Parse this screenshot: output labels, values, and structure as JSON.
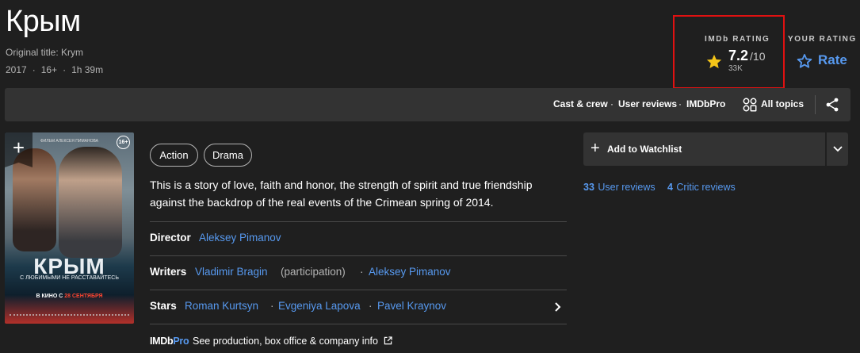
{
  "title": {
    "main": "Крым",
    "original": "Original title: Krym",
    "year": "2017",
    "age": "16+",
    "runtime": "1h 39m",
    "dot": "·"
  },
  "rating": {
    "imdb_label": "IMDb RATING",
    "score": "7.2",
    "out_of": "/10",
    "votes": "33K",
    "your_label": "YOUR RATING",
    "rate_label": "Rate"
  },
  "nav": {
    "cast_crew": "Cast & crew",
    "user_reviews": "User reviews",
    "imdbpro": "IMDbPro",
    "all_topics": "All topics",
    "sep": "·"
  },
  "poster": {
    "top_text": "ФИЛЬМ АЛЕКСЕЯ ПИМАНОВА",
    "age": "16+",
    "name": "КРЫМ",
    "tagline": "С ЛЮБИМЫМИ НЕ РАССТАВАЙТЕСЬ",
    "release_prefix": "В КИНО С",
    "release_date": "28 СЕНТЯБРЯ",
    "add": "+"
  },
  "genres": [
    "Action",
    "Drama"
  ],
  "plot": "This is a story of love, faith and honor, the strength of spirit and true friendship against the backdrop of the real events of the Crimean spring of 2014.",
  "credits": {
    "director_label": "Director",
    "director": "Aleksey Pimanov",
    "writers_label": "Writers",
    "writer1": "Vladimir Bragin",
    "writer1_note": "(participation)",
    "writer2": "Aleksey Pimanov",
    "stars_label": "Stars",
    "star1": "Roman Kurtsyn",
    "star2": "Evgeniya Lapova",
    "star3": "Pavel Kraynov",
    "sep": "·"
  },
  "pro": {
    "logo_a": "IMDb",
    "logo_b": "Pro",
    "text": "See production, box office & company info"
  },
  "watchlist": {
    "label": "Add to Watchlist",
    "plus": "+"
  },
  "reviews": {
    "user_count": "33",
    "user_label": "User reviews",
    "critic_count": "4",
    "critic_label": "Critic reviews"
  },
  "colors": {
    "background": "#1f1f1f",
    "link": "#5799ef",
    "star": "#f5c518",
    "highlight_border": "#e01111"
  }
}
